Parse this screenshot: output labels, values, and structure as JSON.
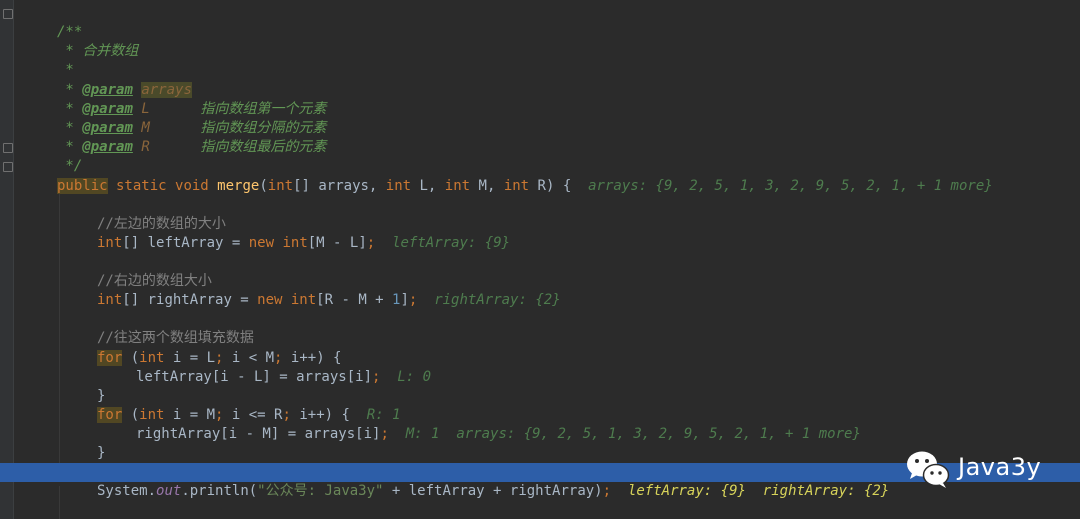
{
  "editor": {
    "lines": {
      "l1": "/**",
      "l2_star": " * ",
      "l2_text": "合并数组",
      "l3": " *",
      "l4_star": " * ",
      "l4_tag": "@param",
      "l4_name": "arrays",
      "l5_tag": "@param",
      "l5_name": "L",
      "l5_desc": "指向数组第一个元素",
      "l6_tag": "@param",
      "l6_name": "M",
      "l6_desc": "指向数组分隔的元素",
      "l7_tag": "@param",
      "l7_name": "R",
      "l7_desc": "指向数组最后的元素",
      "l8": " */",
      "sig_public": "public",
      "sig_static": " static ",
      "sig_void": "void",
      "sig_merge": "merge",
      "sig_open": "(",
      "sig_int1": "int",
      "sig_arr": "[] arrays, ",
      "sig_int2": "int",
      "sig_L": " L, ",
      "sig_int3": "int",
      "sig_M": " M, ",
      "sig_int4": "int",
      "sig_R": " R) {",
      "sig_hint": "arrays: {9, 2, 5, 1, 3, 2, 9, 5, 2, 1, + 1 more}",
      "c_left": "//左边的数组的大小",
      "la_int": "int",
      "la_decl": "[] leftArray = ",
      "la_new": "new",
      "la_int2": " int",
      "la_idx": "[M - L]",
      "la_semi": ";",
      "la_hint": "leftArray: {9}",
      "c_right": "//右边的数组大小",
      "ra_int": "int",
      "ra_decl": "[] rightArray = ",
      "ra_new": "new",
      "ra_int2": " int",
      "ra_idx": "[R - M + ",
      "ra_one": "1",
      "ra_close": "]",
      "ra_semi": ";",
      "ra_hint": "rightArray: {2}",
      "c_fill": "//往这两个数组填充数据",
      "for1_for": "for",
      "for1_open": " (",
      "for1_int": "int",
      "for1_a": " i = L",
      "for1_s1": ";",
      "for1_b": " i < M",
      "for1_s2": ";",
      "for1_c": " i++) {",
      "f1b_text": "leftArray[i - L] = arrays[i]",
      "f1b_semi": ";",
      "f1b_hint": "L: 0",
      "close1": "}",
      "for2_for": "for",
      "for2_open": " (",
      "for2_int": "int",
      "for2_a": " i = M",
      "for2_s1": ";",
      "for2_b": " i <= R",
      "for2_s2": ";",
      "for2_c": " i++) {",
      "for2_hint": "R: 1",
      "f2b_text": "rightArray[i - M] = arrays[i]",
      "f2b_semi": ";",
      "f2b_hint1": "M: 1",
      "f2b_hint2": "arrays: {9, 2, 5, 1, 3, 2, 9, 5, 2, 1, + 1 more}",
      "close2": "}",
      "sys_a": "System.",
      "sys_out": "out",
      "sys_b": ".println(",
      "sys_str": "\"公众号: Java3y\"",
      "sys_c": " + leftArray + rightArray)",
      "sys_semi": ";",
      "sys_hint1": "leftArray: {9}",
      "sys_hint2": "rightArray: {2}"
    }
  },
  "watermark": {
    "text": "Java3y",
    "icon": "wechat-icon"
  }
}
